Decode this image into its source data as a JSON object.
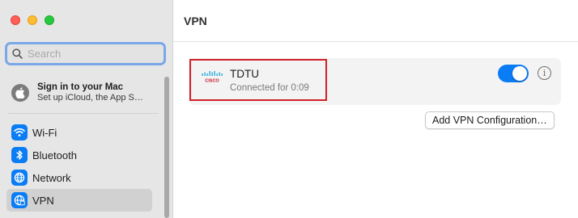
{
  "window": {
    "traffic_lights": [
      "close",
      "minimize",
      "maximize"
    ]
  },
  "sidebar": {
    "search": {
      "placeholder": "Search",
      "value": ""
    },
    "account": {
      "title": "Sign in to your Mac",
      "subtitle": "Set up iCloud, the App S…"
    },
    "items": [
      {
        "label": "Wi-Fi",
        "icon": "wifi-icon",
        "active": false
      },
      {
        "label": "Bluetooth",
        "icon": "bluetooth-icon",
        "active": false
      },
      {
        "label": "Network",
        "icon": "globe-icon",
        "active": false
      },
      {
        "label": "VPN",
        "icon": "vpn-globe-icon",
        "active": true
      }
    ]
  },
  "main": {
    "title": "VPN",
    "vpn": {
      "logo_text": "CISCO",
      "name": "TDTU",
      "status": "Connected for 0:09",
      "enabled": true
    },
    "add_button": "Add VPN Configuration…"
  },
  "colors": {
    "accent": "#0a7cf5",
    "highlight": "#d2212a",
    "sidebar_bg": "#e7e6e6"
  }
}
